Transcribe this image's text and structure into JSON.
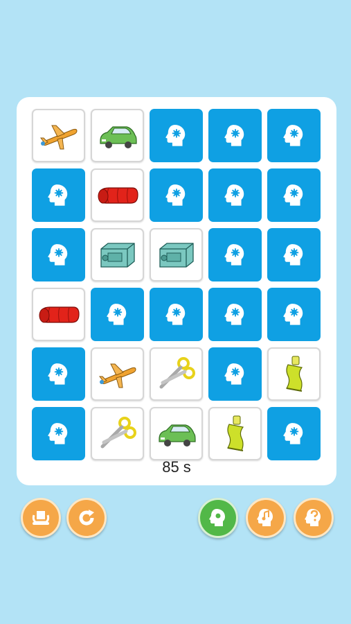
{
  "game": {
    "timer_text": "85 s",
    "hidden_card_icon": "head-gear-icon",
    "grid": [
      [
        "airplane",
        "car",
        "hidden",
        "hidden",
        "hidden"
      ],
      [
        "hidden",
        "sleeping-bag",
        "hidden",
        "hidden",
        "hidden"
      ],
      [
        "hidden",
        "sharpener",
        "sharpener",
        "hidden",
        "hidden"
      ],
      [
        "sleeping-bag",
        "hidden",
        "hidden",
        "hidden",
        "hidden"
      ],
      [
        "hidden",
        "airplane",
        "scissors",
        "hidden",
        "glue-tube"
      ],
      [
        "hidden",
        "scissors",
        "car",
        "glue-tube",
        "hidden"
      ]
    ]
  },
  "toolbar": {
    "buttons": [
      {
        "name": "cards-button",
        "icon": "cards-icon",
        "color": "#f5a748"
      },
      {
        "name": "restart-button",
        "icon": "restart-icon",
        "color": "#f5a748"
      },
      {
        "name": "theme-button",
        "icon": "head-gear-icon",
        "color": "#52b848"
      },
      {
        "name": "sound-button",
        "icon": "head-music-icon",
        "color": "#f5a748"
      },
      {
        "name": "help-button",
        "icon": "head-question-icon",
        "color": "#f5a748"
      }
    ]
  },
  "colors": {
    "background": "#b3e3f6",
    "card_back": "#0fa0e3",
    "button_orange": "#f5a748",
    "button_green": "#52b848"
  }
}
